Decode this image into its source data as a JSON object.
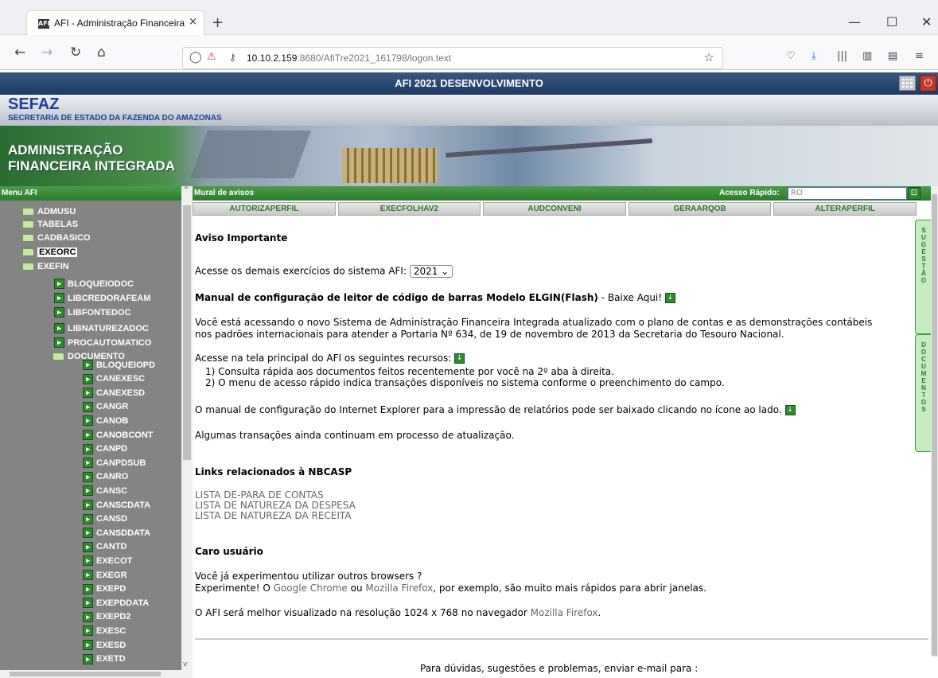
{
  "browser": {
    "tab_title": "AFI - Administração Financeira",
    "tab_close": "×",
    "new_tab": "+",
    "url_prefix": "10.10.2.159",
    "url_rest": ":8680/AfiTre2021_161798/logon.text",
    "window": {
      "minimize": "—",
      "maximize": "☐",
      "close": "✕"
    }
  },
  "app": {
    "title": "AFI 2021 DESENVOLVIMENTO",
    "org": "SEFAZ",
    "org_full": "SECRETARIA DE ESTADO DA FAZENDA DO AMAZONAS",
    "system_line1": "ADMINISTRAÇÃO",
    "system_line2": "FINANCEIRA INTEGRADA"
  },
  "sidebar": {
    "header": "Menu AFI",
    "top_items": [
      {
        "label": "ADMUSU"
      },
      {
        "label": "TABELAS"
      },
      {
        "label": "CADBASICO"
      },
      {
        "label": "EXEORC"
      },
      {
        "label": "EXEFIN"
      }
    ],
    "exefin_items": [
      {
        "label": "BLOQUEIODOC"
      },
      {
        "label": "LIBCREDORAFEAM"
      },
      {
        "label": "LIBFONTEDOC"
      },
      {
        "label": "LIBNATUREZADOC"
      },
      {
        "label": "PROCAUTOMATICO"
      },
      {
        "label": "DOCUMENTO"
      }
    ],
    "documento_items": [
      {
        "label": "BLOQUEIOPD"
      },
      {
        "label": "CANEXESC"
      },
      {
        "label": "CANEXESD"
      },
      {
        "label": "CANGR"
      },
      {
        "label": "CANOB"
      },
      {
        "label": "CANOBCONT"
      },
      {
        "label": "CANPD"
      },
      {
        "label": "CANPDSUB"
      },
      {
        "label": "CANRO"
      },
      {
        "label": "CANSC"
      },
      {
        "label": "CANSCDATA"
      },
      {
        "label": "CANSD"
      },
      {
        "label": "CANSDDATA"
      },
      {
        "label": "CANTD"
      },
      {
        "label": "EXECOT"
      },
      {
        "label": "EXEGR"
      },
      {
        "label": "EXEPD"
      },
      {
        "label": "EXEPDDATA"
      },
      {
        "label": "EXEPD2"
      },
      {
        "label": "EXESC"
      },
      {
        "label": "EXESD"
      },
      {
        "label": "EXETD"
      }
    ]
  },
  "main": {
    "header": "Mural de avisos",
    "quick_access_label": "Acesso Rápido:",
    "quick_access_value": "RO",
    "quick_access_button": "Ŀ",
    "tabs": [
      {
        "label": "AUTORIZAPERFIL"
      },
      {
        "label": "EXECFOLHAV2"
      },
      {
        "label": "AUDCONVENI"
      },
      {
        "label": "GERAARQOB"
      },
      {
        "label": "ALTERAPERFIL"
      }
    ],
    "side_tab_suggestion": "SUGESTÃO",
    "side_tab_documents": "DOCUMENTOS",
    "aviso_title": "Aviso Importante",
    "exercicios_text": "Acesse os demais exercícios do sistema AFI:",
    "year": "2021",
    "manual_title": "Manual de configuração de leitor de código de barras Modelo ELGIN(Flash)",
    "manual_suffix": " - Baixe Aqui!",
    "novo_line1": "Você está acessando o novo Sistema de Administração Financeira Integrada atualizado com o plano de contas e as demonstrações contábeis",
    "novo_line2": "nos padrões internacionais para atender a Portaria Nº 634, de 19 de novembro de 2013 da Secretaria do Tesouro Nacional.",
    "recursos_intro": "Acesse na tela principal do AFI os seguintes recursos:",
    "recursos_1": "1) Consulta rápida aos documentos feitos recentemente por você na 2º aba à direita.",
    "recursos_2": "2) O menu de acesso rápido indica transações disponíveis no sistema conforme o preenchimento do campo.",
    "ie_manual": "O manual de configuração do Internet Explorer para a impressão de relatórios pode ser baixado clicando no ícone ao lado.",
    "atualizacao": "Algumas transações ainda continuam em processo de atualização.",
    "links_title": "Links relacionados à NBCASP",
    "links": [
      {
        "label": "LISTA DE-PARA DE CONTAS"
      },
      {
        "label": "LISTA DE NATUREZA DA DESPESA"
      },
      {
        "label": "LISTA DE NATUREZA DA RECEITA"
      }
    ],
    "caro_title": "Caro usuário",
    "browsers_q": "Você já experimentou utilizar outros browsers ?",
    "exp_a": "Experimente! O ",
    "chrome": "Google Chrome",
    "exp_or": " ou ",
    "firefox": "Mozilla Firefox",
    "exp_b": ", por exemplo, são muito mais rápidos para abrir janelas.",
    "res_a": "O AFI será melhor visualizado na resolução 1024 x 768 no navegador ",
    "res_ff": "Mozilla Firefox",
    "res_dot": ".",
    "footer": "Para dúvidas, sugestões e problemas, enviar e-mail para :"
  },
  "colors": {
    "header_green": "#2d7a2d",
    "sidebar_gray": "#848484",
    "app_bar_blue": "#1d3a63"
  }
}
